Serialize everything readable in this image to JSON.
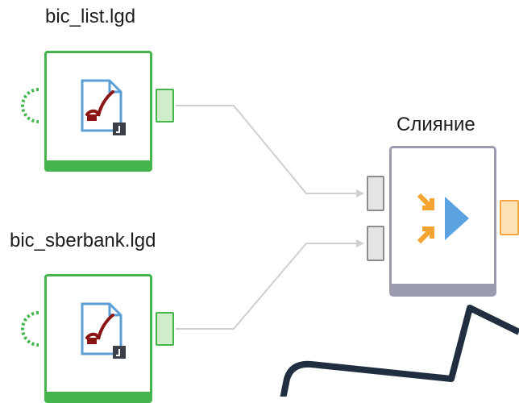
{
  "nodes": {
    "source_1": {
      "title": "bic_list.lgd",
      "icon": "file-transform-icon"
    },
    "source_2": {
      "title": "bic_sberbank.lgd",
      "icon": "file-transform-icon"
    },
    "merge": {
      "title": "Слияние",
      "icon": "merge-icon"
    }
  },
  "colors": {
    "source_accent": "#43b54c",
    "merge_accent": "#9b9bb0",
    "output_port": "#f5a542",
    "merge_icon_orange": "#f5a331",
    "merge_icon_blue": "#5aa3e0",
    "wire": "#cfcfcf",
    "overlay_stroke": "#1f2f40"
  }
}
